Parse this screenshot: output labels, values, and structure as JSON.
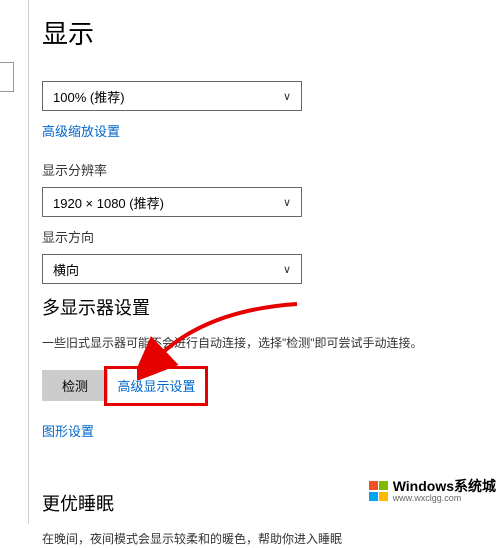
{
  "page_title": "显示",
  "scale": {
    "value": "100% (推荐)",
    "advanced_link": "高级缩放设置"
  },
  "resolution": {
    "label": "显示分辨率",
    "value": "1920 × 1080 (推荐)"
  },
  "orientation": {
    "label": "显示方向",
    "value": "横向"
  },
  "multi_display": {
    "heading": "多显示器设置",
    "help": "一些旧式显示器可能不会进行自动连接，选择\"检测\"即可尝试手动连接。",
    "detect_button": "检测",
    "advanced_link": "高级显示设置",
    "graphics_link": "图形设置"
  },
  "sleep": {
    "heading": "更优睡眠",
    "help": "在晚间，夜间模式会显示较柔和的暖色，帮助你进入睡眠"
  },
  "watermark": {
    "main": "Windows系统城",
    "sub": "www.wxclgg.com"
  }
}
